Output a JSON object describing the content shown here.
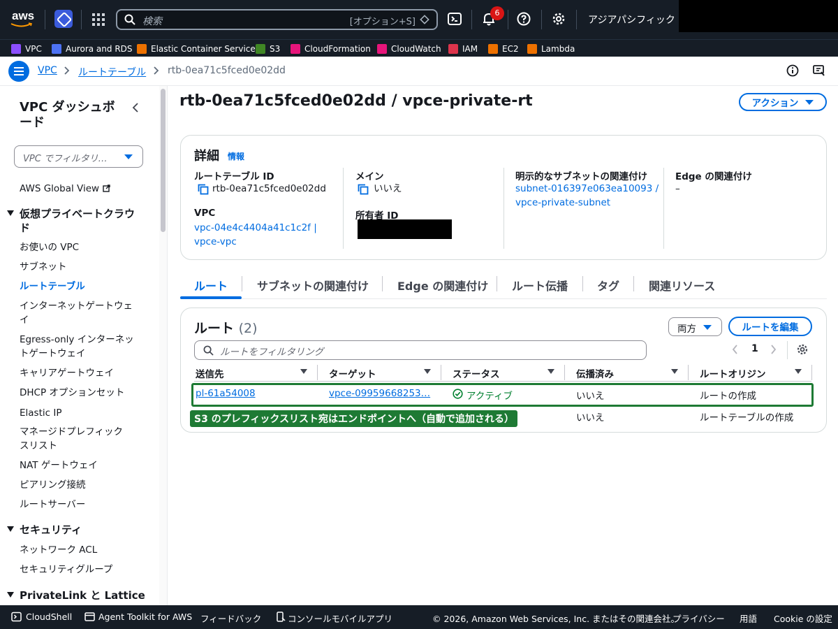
{
  "topnav": {
    "logo_text": "aws",
    "search_placeholder": "検索",
    "search_shortcut": "[オプション+S]",
    "notification_count": "6",
    "region": "アジアパシフィック (東京)"
  },
  "favorites": [
    {
      "label": "VPC",
      "color": "#8c4fff"
    },
    {
      "label": "Aurora and RDS",
      "color": "#4d72f3"
    },
    {
      "label": "Elastic Container Service",
      "color": "#ed7100"
    },
    {
      "label": "S3",
      "color": "#3f8624"
    },
    {
      "label": "CloudFormation",
      "color": "#e7157b"
    },
    {
      "label": "CloudWatch",
      "color": "#e7157b"
    },
    {
      "label": "IAM",
      "color": "#dd344c"
    },
    {
      "label": "EC2",
      "color": "#ed7100"
    },
    {
      "label": "Lambda",
      "color": "#ed7100"
    }
  ],
  "breadcrumb": {
    "items": [
      "VPC",
      "ルートテーブル"
    ],
    "current": "rtb-0ea71c5fced0e02dd"
  },
  "sidebar": {
    "title": "VPC ダッシュボード",
    "filter_placeholder": "VPC でフィルタリ…",
    "global_view": "AWS Global View",
    "section1": "仮想プライベートクラウド",
    "items1": [
      "お使いの VPC",
      "サブネット",
      "ルートテーブル",
      "インターネットゲートウェイ",
      "Egress-only インターネットゲートウェイ",
      "キャリアゲートウェイ",
      "DHCP オプションセット",
      "Elastic IP",
      "マネージドプレフィックスリスト",
      "NAT ゲートウェイ",
      "ピアリング接続",
      "ルートサーバー"
    ],
    "section2": "セキュリティ",
    "items2": [
      "ネットワーク ACL",
      "セキュリティグループ"
    ],
    "section3": "PrivateLink と Lattice"
  },
  "page": {
    "title": "rtb-0ea71c5fced0e02dd / vpce-private-rt",
    "actions_label": "アクション"
  },
  "details": {
    "heading": "詳細",
    "info": "情報",
    "rtb_id_label": "ルートテーブル ID",
    "rtb_id_value": "rtb-0ea71c5fced0e02dd",
    "main_label": "メイン",
    "main_value": "いいえ",
    "subnet_assoc_label": "明示的なサブネットの関連付け",
    "subnet_assoc_line1": "subnet-016397e063ea10093 /",
    "subnet_assoc_line2": "vpce-private-subnet",
    "edge_label": "Edge の関連付け",
    "edge_value": "–",
    "vpc_label": "VPC",
    "vpc_line1": "vpc-04e4c4404a41c1c2f |",
    "vpc_line2": "vpce-vpc",
    "owner_label": "所有者 ID"
  },
  "tabs": [
    "ルート",
    "サブネットの関連付け",
    "Edge の関連付け",
    "ルート伝播",
    "タグ",
    "関連リソース"
  ],
  "routes": {
    "heading": "ルート",
    "count": "(2)",
    "select_value": "両方",
    "edit_button": "ルートを編集",
    "filter_placeholder": "ルートをフィルタリング",
    "page_number": "1",
    "columns": [
      "送信先",
      "ターゲット",
      "ステータス",
      "伝播済み",
      "ルートオリジン"
    ],
    "rows": [
      {
        "destination": "pl-61a54008",
        "target": "vpce-09959668253…",
        "status": "アクティブ",
        "propagated": "いいえ",
        "origin": "ルートの作成"
      },
      {
        "destination": "",
        "target": "",
        "status": "",
        "propagated": "いいえ",
        "origin": "ルートテーブルの作成"
      }
    ],
    "callout": "S3 のプレフィックスリスト宛はエンドポイントへ（自動で追加される）"
  },
  "footer": {
    "cloudshell": "CloudShell",
    "agent_toolkit": "Agent Toolkit for AWS",
    "feedback": "フィードバック",
    "mobile": "コンソールモバイルアプリ",
    "copyright": "© 2026, Amazon Web Services, Inc. またはその関連会社。",
    "privacy": "プライバシー",
    "terms": "用語",
    "cookie": "Cookie の設定"
  },
  "colors": {
    "accent": "#006ce0",
    "highlight": "#1e7a34",
    "nav_bg": "#161d26"
  }
}
